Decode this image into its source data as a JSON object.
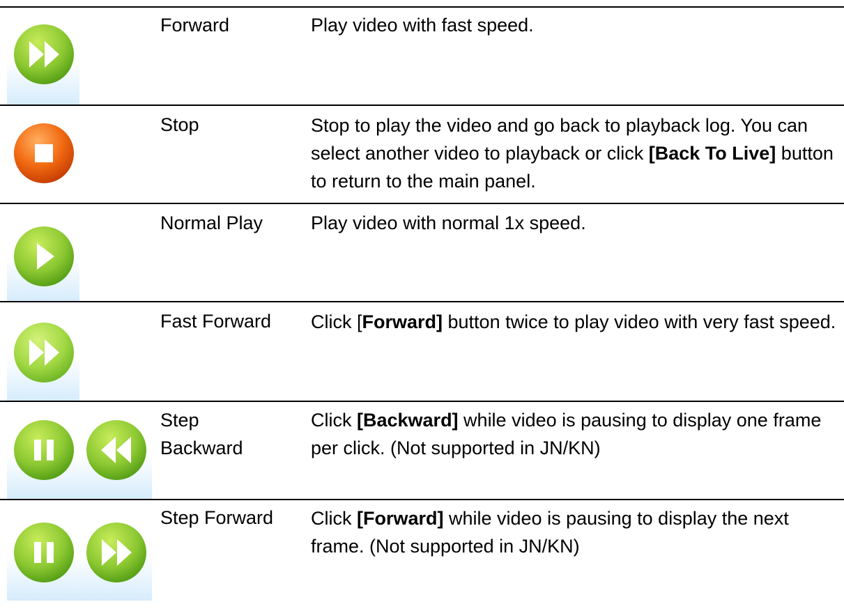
{
  "rows": [
    {
      "name": "Forward",
      "icons": [
        "forward-icon"
      ],
      "desc": [
        {
          "t": "Play video with fast speed.",
          "b": false
        }
      ]
    },
    {
      "name": "Stop",
      "icons": [
        "stop-icon"
      ],
      "desc": [
        {
          "t": "Stop to play the video and go back to playback log. You can select another video to playback or click ",
          "b": false
        },
        {
          "t": "[Back To Live]",
          "b": true
        },
        {
          "t": " button to return to the main panel.",
          "b": false
        }
      ]
    },
    {
      "name": "Normal Play",
      "icons": [
        "play-icon"
      ],
      "desc": [
        {
          "t": "Play video with normal 1x speed.",
          "b": false
        }
      ]
    },
    {
      "name": "Fast Forward",
      "icons": [
        "fast-forward-icon"
      ],
      "desc": [
        {
          "t": "Click [",
          "b": false
        },
        {
          "t": "Forward]",
          "b": true
        },
        {
          "t": " button twice to play video with very fast speed.",
          "b": false
        }
      ]
    },
    {
      "name": "Step\nBackward",
      "icons": [
        "pause-icon",
        "rewind-icon"
      ],
      "desc": [
        {
          "t": "Click ",
          "b": false
        },
        {
          "t": "[Backward]",
          "b": true
        },
        {
          "t": " while video is pausing to display one frame per click. (Not supported in JN/KN)",
          "b": false
        }
      ]
    },
    {
      "name": "Step Forward",
      "icons": [
        "pause-icon",
        "forward-icon"
      ],
      "desc": [
        {
          "t": "Click ",
          "b": false
        },
        {
          "t": "[Forward]",
          "b": true
        },
        {
          "t": " while video is pausing to display the next frame. (Not supported in JN/KN)",
          "b": false
        }
      ]
    }
  ],
  "colors": {
    "green_light": "#b9e04a",
    "green_dark": "#4f9a12",
    "orange_light": "#ff9a4a",
    "orange_dark": "#c23a00",
    "rule": "#000000"
  }
}
